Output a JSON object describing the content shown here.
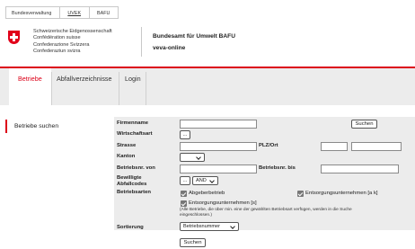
{
  "breadcrumb": {
    "items": [
      "Bundesverwaltung",
      "UVEK",
      "BAFU"
    ]
  },
  "header": {
    "confederation_lines": [
      "Schweizerische Eidgenossenschaft",
      "Confédération suisse",
      "Confederazione Svizzera",
      "Confederaziun svizra"
    ],
    "office_name": "Bundesamt für Umwelt BAFU",
    "app_name": "veva-online"
  },
  "nav": {
    "tabs": [
      "Betriebe",
      "Abfallverzeichnisse",
      "Login"
    ],
    "active": "Betriebe"
  },
  "sidebar": {
    "items": [
      "Betriebe suchen"
    ]
  },
  "form": {
    "firmenname_label": "Firmenname",
    "wirtschaftsart_label": "Wirtschaftsart",
    "strasse_label": "Strasse",
    "plz_ort_label": "PLZ/Ort",
    "kanton_label": "Kanton",
    "betriebsnr_von_label": "Betriebsnr. von",
    "betriebsnr_bis_label": "Betriebsnr. bis",
    "bewilligte_label_1": "Bewilligte",
    "bewilligte_label_2": "Abfallcodes",
    "betriebsarten_label": "Betriebsarten",
    "sortierung_label": "Sortierung",
    "lookup_button": "...",
    "and_operator": "AND",
    "search_button_top": "Suchen",
    "search_button_bottom": "Suchen",
    "sort_value": "Betriebsnummer",
    "checkbox_abgeberbetrieb": "Abgeberbetrieb",
    "checkbox_entsorgung_ak": "Entsorgungsunternehmen [a k]",
    "checkbox_entsorgung_s": "Entsorgungsunternehmen [s]",
    "hint_line_1": "(Alle Betriebe, die über min. eine der gewählten Betriebsart verfügen, werden in die Suche",
    "hint_line_2": "eingeschlossen.)"
  }
}
